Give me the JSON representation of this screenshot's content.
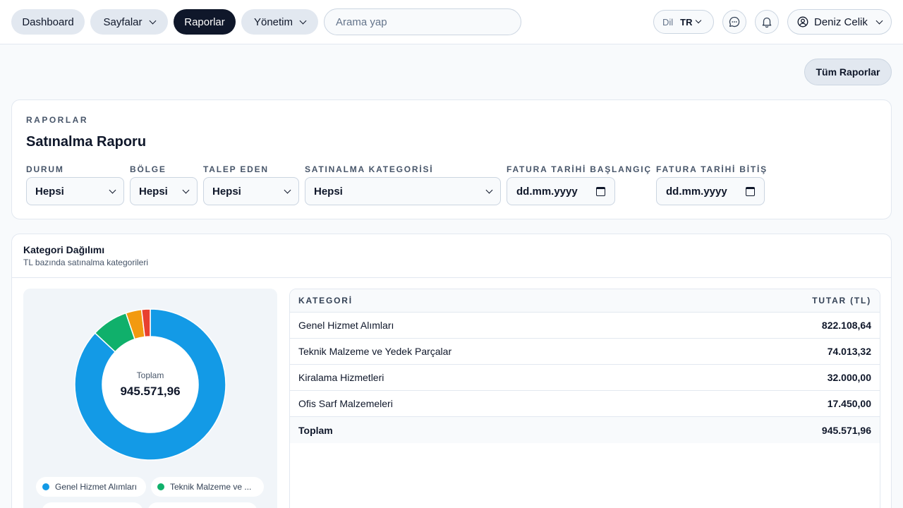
{
  "nav": {
    "dashboard": "Dashboard",
    "pages": "Sayfalar",
    "reports": "Raporlar",
    "management": "Yönetim",
    "search_placeholder": "Arama yap",
    "lang_label": "Dil",
    "lang_value": "TR",
    "user_name": "Deniz Celik",
    "icons": [
      "chat-icon",
      "bell-icon",
      "user-circle-icon"
    ]
  },
  "actions": {
    "all_reports": "Tüm Raporlar"
  },
  "filters": {
    "eyebrow": "RAPORLAR",
    "title": "Satınalma Raporu",
    "status": {
      "label": "DURUM",
      "value": "Hepsi"
    },
    "region": {
      "label": "BÖLGE",
      "value": "Hepsi"
    },
    "requester": {
      "label": "TALEP EDEN",
      "value": "Hepsi"
    },
    "category": {
      "label": "SATINALMA KATEGORİSİ",
      "value": "Hepsi"
    },
    "invoice_start": {
      "label": "FATURA TARİHİ BAŞLANGIÇ",
      "value": "dd.mm.yyyy"
    },
    "invoice_end": {
      "label": "FATURA TARİHİ BİTİŞ",
      "value": "dd.mm.yyyy"
    }
  },
  "category_card": {
    "title": "Kategori Dağılımı",
    "subtitle": "TL bazında satınalma kategorileri",
    "center_label": "Toplam",
    "center_value": "945.571,96",
    "legend": [
      "Genel Hizmet Alımları",
      "Teknik Malzeme ve ..."
    ],
    "table": {
      "col_category": "KATEGORİ",
      "col_amount": "TUTAR (TL)",
      "rows": [
        {
          "name": "Genel Hizmet Alımları",
          "amount": "822.108,64"
        },
        {
          "name": "Teknik Malzeme ve Yedek Parçalar",
          "amount": "74.013,32"
        },
        {
          "name": "Kiralama Hizmetleri",
          "amount": "32.000,00"
        },
        {
          "name": "Ofis Sarf Malzemeleri",
          "amount": "17.450,00"
        }
      ],
      "total_label": "Toplam",
      "total_amount": "945.571,96"
    }
  },
  "chart_data": {
    "type": "pie",
    "categories": [
      "Genel Hizmet Alımları",
      "Teknik Malzeme ve Yedek Parçalar",
      "Kiralama Hizmetleri",
      "Ofis Sarf Malzemeleri"
    ],
    "values": [
      822108.64,
      74013.32,
      32000.0,
      17450.0
    ],
    "colors": [
      "#139ae6",
      "#10b06b",
      "#f29a10",
      "#e8402f"
    ]
  }
}
